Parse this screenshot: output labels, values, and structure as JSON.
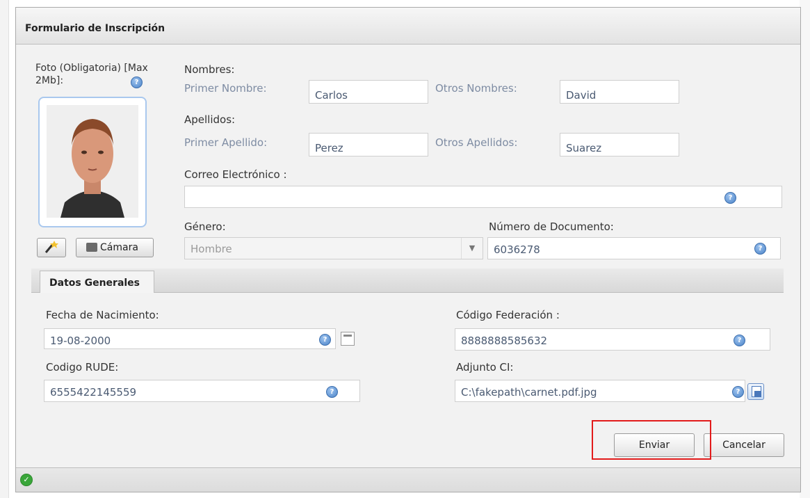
{
  "window": {
    "title": "Formulario de Inscripción"
  },
  "photo": {
    "label": "Foto (Obligatoria) [Max 2Mb]:",
    "camera_button": "Cámara",
    "wand_icon": "magic-wand-icon",
    "camera_icon": "camera-icon"
  },
  "names": {
    "section_label": "Nombres:",
    "first_label": "Primer Nombre:",
    "first_value": "Carlos",
    "other_label": "Otros Nombres:",
    "other_value": "David"
  },
  "surnames": {
    "section_label": "Apellidos:",
    "first_label": "Primer Apellido:",
    "first_value": "Perez",
    "other_label": "Otros Apellidos:",
    "other_value": "Suarez"
  },
  "email": {
    "label": "Correo Electrónico :",
    "value": ""
  },
  "gender": {
    "label": "Género:",
    "value": "Hombre"
  },
  "document": {
    "label": "Número de Documento:",
    "value": "6036278"
  },
  "tabs": [
    {
      "label": "Datos Generales"
    }
  ],
  "general": {
    "birth_label": "Fecha de Nacimiento:",
    "birth_value": "19-08-2000",
    "federation_label": "Código Federación :",
    "federation_value": "8888888585632",
    "rude_label": "Codigo RUDE:",
    "rude_value": "6555422145559",
    "ci_label": "Adjunto CI:",
    "ci_value": "C:\\fakepath\\carnet.pdf.jpg"
  },
  "actions": {
    "submit": "Enviar",
    "cancel": "Cancelar"
  },
  "colors": {
    "highlight": "#e21b1b",
    "help_icon": "#4a83c8",
    "status_ok": "#3aa63a"
  }
}
